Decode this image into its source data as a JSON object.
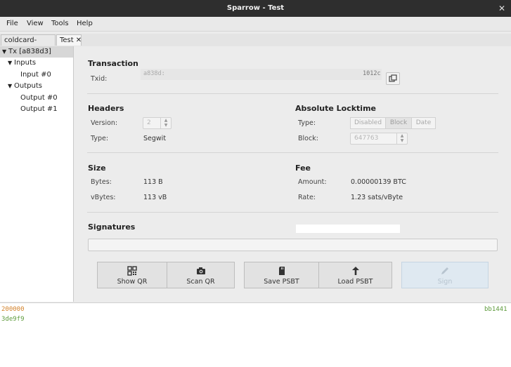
{
  "window": {
    "title": "Sparrow - Test",
    "close_glyph": "✕"
  },
  "menu": [
    "File",
    "View",
    "Tools",
    "Help"
  ],
  "tabs": [
    {
      "label": "coldcard-export"
    },
    {
      "label": "Test",
      "close": "✕"
    }
  ],
  "tree": {
    "root": "Tx [a838d3]",
    "inputs": "Inputs",
    "input0": "Input #0",
    "outputs": "Outputs",
    "output0": "Output #0",
    "output1": "Output #1"
  },
  "transaction": {
    "heading": "Transaction",
    "txid_label": "Txid:",
    "txid_start": "a838d:",
    "txid_end": "1012c",
    "copy_icon": "copy-icon"
  },
  "headers": {
    "heading": "Headers",
    "version_label": "Version:",
    "version_value": "2",
    "type_label": "Type:",
    "type_value": "Segwit"
  },
  "locktime": {
    "heading": "Absolute Locktime",
    "type_label": "Type:",
    "options": [
      "Disabled",
      "Block",
      "Date"
    ],
    "selected": "Block",
    "block_label": "Block:",
    "block_value": "647763"
  },
  "size": {
    "heading": "Size",
    "bytes_label": "Bytes:",
    "bytes_value": "113 B",
    "vbytes_label": "vBytes:",
    "vbytes_value": "113 vB"
  },
  "fee": {
    "heading": "Fee",
    "amount_label": "Amount:",
    "amount_value": "0.00000139 BTC",
    "rate_label": "Rate:",
    "rate_value": "1.23 sats/vByte"
  },
  "signatures": {
    "heading": "Signatures"
  },
  "buttons": {
    "show_qr": "Show QR",
    "scan_qr": "Scan QR",
    "save_psbt": "Save PSBT",
    "load_psbt": "Load PSBT",
    "sign": "Sign"
  },
  "console": {
    "line1": "200000",
    "line1_right": "bb1441",
    "line2": "3de9f9"
  },
  "colors": {
    "orange": "#d3822a",
    "green": "#5c9a3a",
    "sign_disabled": "#dfe9f1"
  }
}
